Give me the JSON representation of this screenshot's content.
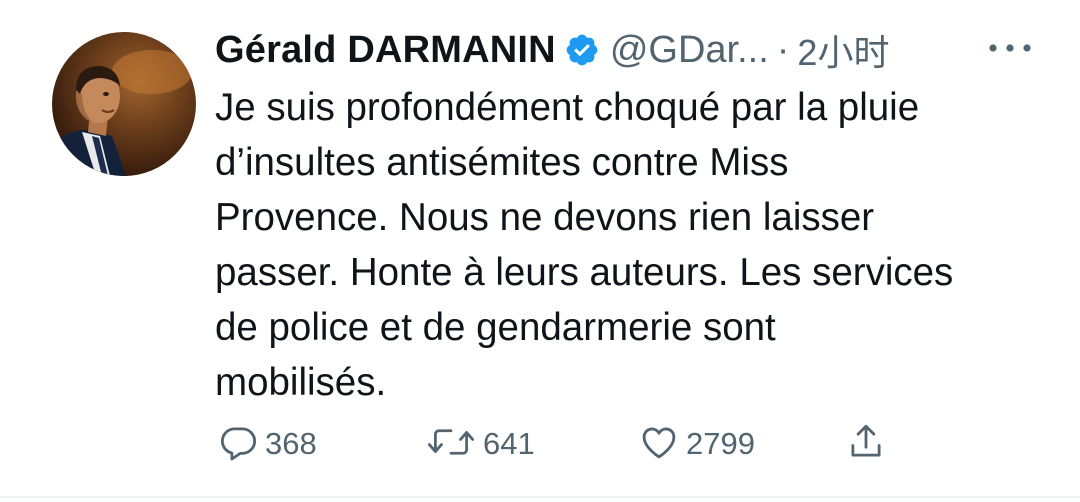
{
  "tweet": {
    "author_name": "Gérald DARMANIN",
    "handle": "@GDar...",
    "separator": "·",
    "time": "2小时",
    "text": "Je suis profondément choqué par la pluie\nd’insultes antisémites contre Miss\nProvence. Nous ne devons rien laisser\npasser. Honte à leurs auteurs. Les services\nde police et de gendarmerie sont\nmobilisés.",
    "verified": true
  },
  "actions": {
    "reply_count": "368",
    "retweet_count": "641",
    "like_count": "2799"
  },
  "icons": {
    "verified": "verified-badge-icon",
    "more": "more-options-icon",
    "reply": "reply-icon",
    "retweet": "retweet-icon",
    "like": "heart-icon",
    "share": "share-icon"
  },
  "colors": {
    "text": "#0f1419",
    "secondary": "#536471",
    "verified_blue": "#1d9bf0"
  }
}
